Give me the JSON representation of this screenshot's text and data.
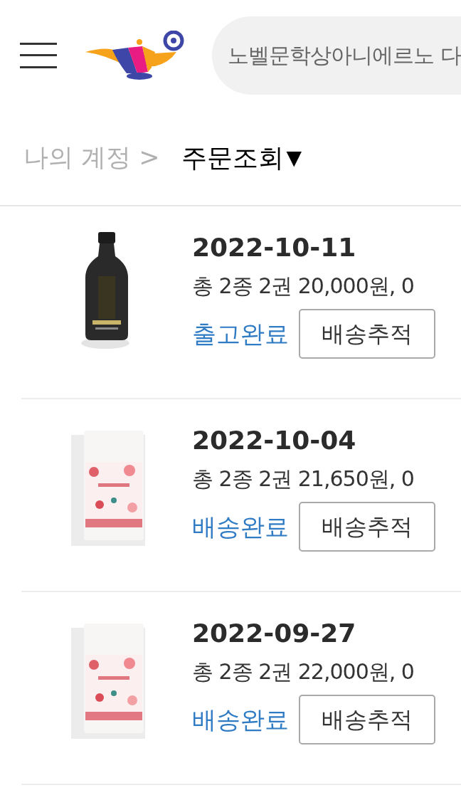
{
  "header": {
    "search": {
      "value": "노벨문학상아니에르노 다"
    }
  },
  "breadcrumb": {
    "parent": "나의 계정 >",
    "current": "주문조회",
    "dropdown_icon": "▼"
  },
  "orders": [
    {
      "date": "2022-10-11",
      "summary": "총 2종 2권 20,000원, 0",
      "status": "출고완료",
      "button": "배송추적"
    },
    {
      "date": "2022-10-04",
      "summary": "총 2종 2권 21,650원, 0",
      "status": "배송완료",
      "button": "배송추적"
    },
    {
      "date": "2022-09-27",
      "summary": "총 2종 2권 22,000원, 0",
      "status": "배송완료",
      "button": "배송추적"
    }
  ]
}
